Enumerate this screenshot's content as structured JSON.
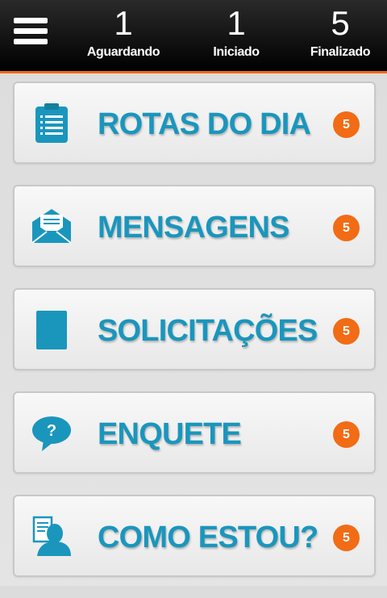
{
  "header": {
    "stats": [
      {
        "value": "1",
        "label": "Aguardando"
      },
      {
        "value": "1",
        "label": "Iniciado"
      },
      {
        "value": "5",
        "label": "Finalizado"
      }
    ]
  },
  "menu": {
    "items": [
      {
        "label": "ROTAS DO DIA",
        "badge": "5",
        "icon": "clipboard-icon"
      },
      {
        "label": "MENSAGENS",
        "badge": "5",
        "icon": "envelope-icon"
      },
      {
        "label": "SOLICITAÇÕES",
        "badge": "5",
        "icon": "document-icon"
      },
      {
        "label": "ENQUETE",
        "badge": "5",
        "icon": "question-bubble-icon"
      },
      {
        "label": "COMO ESTOU?",
        "badge": "5",
        "icon": "user-report-icon"
      }
    ]
  },
  "colors": {
    "accent": "#1a96bd",
    "badge": "#f26b15",
    "header": "#111111",
    "header_border": "#ee6a1a"
  }
}
